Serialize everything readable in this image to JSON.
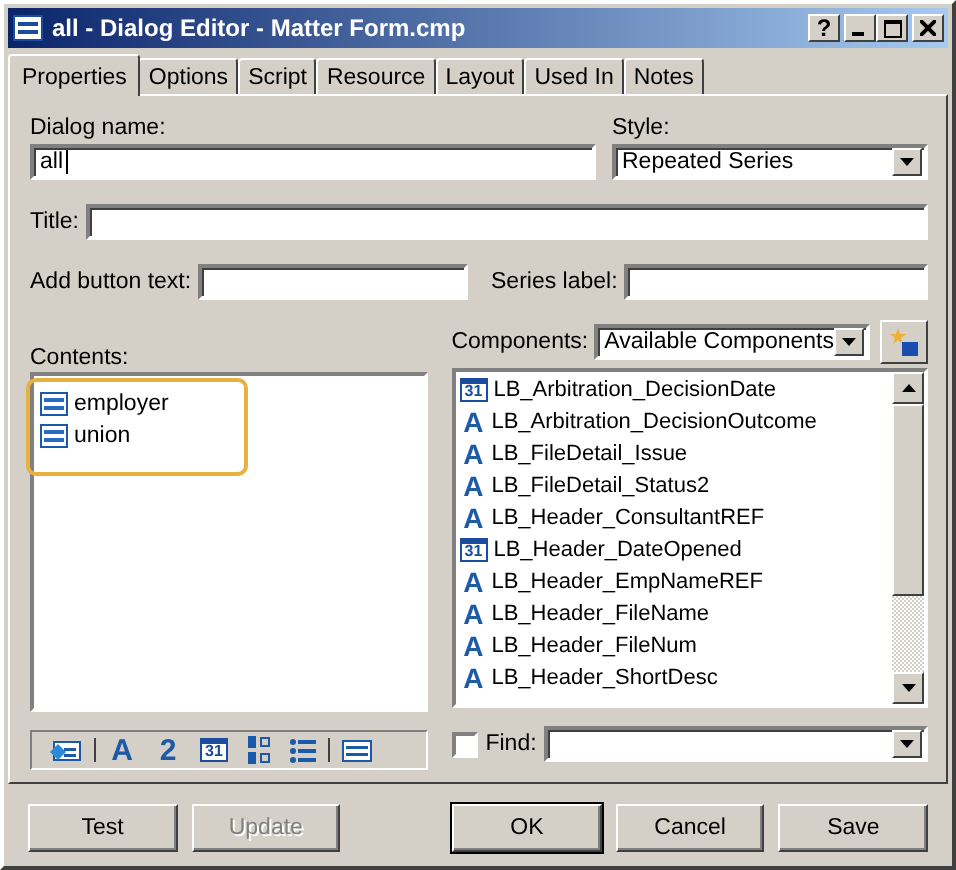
{
  "window": {
    "title": "all - Dialog Editor - Matter Form.cmp",
    "help": "?"
  },
  "tabs": [
    {
      "label": "Properties",
      "selected": true
    },
    {
      "label": "Options",
      "selected": false
    },
    {
      "label": "Script",
      "selected": false
    },
    {
      "label": "Resource",
      "selected": false
    },
    {
      "label": "Layout",
      "selected": false
    },
    {
      "label": "Used In",
      "selected": false
    },
    {
      "label": "Notes",
      "selected": false
    }
  ],
  "dialog_name": {
    "label": "Dialog name:",
    "value": "all"
  },
  "style": {
    "label": "Style:",
    "value": "Repeated Series"
  },
  "title_field": {
    "label": "Title:"
  },
  "add_button_text": {
    "label": "Add button text:"
  },
  "series_label": {
    "label": "Series label:"
  },
  "contents": {
    "label": "Contents:",
    "items": [
      {
        "label": "employer"
      },
      {
        "label": "union"
      }
    ]
  },
  "components": {
    "label": "Components:",
    "filter": "Available Components",
    "items": [
      {
        "kind": "date",
        "glyph": "31",
        "label": "LB_Arbitration_DecisionDate"
      },
      {
        "kind": "text",
        "glyph": "A",
        "label": "LB_Arbitration_DecisionOutcome"
      },
      {
        "kind": "text",
        "glyph": "A",
        "label": "LB_FileDetail_Issue"
      },
      {
        "kind": "text",
        "glyph": "A",
        "label": "LB_FileDetail_Status2"
      },
      {
        "kind": "text",
        "glyph": "A",
        "label": "LB_Header_ConsultantREF"
      },
      {
        "kind": "date",
        "glyph": "31",
        "label": "LB_Header_DateOpened"
      },
      {
        "kind": "text",
        "glyph": "A",
        "label": "LB_Header_EmpNameREF"
      },
      {
        "kind": "text",
        "glyph": "A",
        "label": "LB_Header_FileName"
      },
      {
        "kind": "text",
        "glyph": "A",
        "label": "LB_Header_FileNum"
      },
      {
        "kind": "text",
        "glyph": "A",
        "label": "LB_Header_ShortDesc"
      }
    ]
  },
  "toolbar": [
    {
      "kind": "picture"
    },
    {
      "kind": "sep"
    },
    {
      "kind": "text",
      "glyph": "A"
    },
    {
      "kind": "text",
      "glyph": "2"
    },
    {
      "kind": "date",
      "glyph": "31"
    },
    {
      "kind": "taborder"
    },
    {
      "kind": "list"
    },
    {
      "kind": "sep"
    },
    {
      "kind": "series"
    }
  ],
  "find": {
    "label": "Find:",
    "checked": false
  },
  "buttons": [
    {
      "label": "Test",
      "disabled": false,
      "default": false
    },
    {
      "label": "Update",
      "disabled": true,
      "default": false
    },
    {
      "label": "OK",
      "disabled": false,
      "default": true
    },
    {
      "label": "Cancel",
      "disabled": false,
      "default": false
    },
    {
      "label": "Save",
      "disabled": false,
      "default": false
    }
  ]
}
